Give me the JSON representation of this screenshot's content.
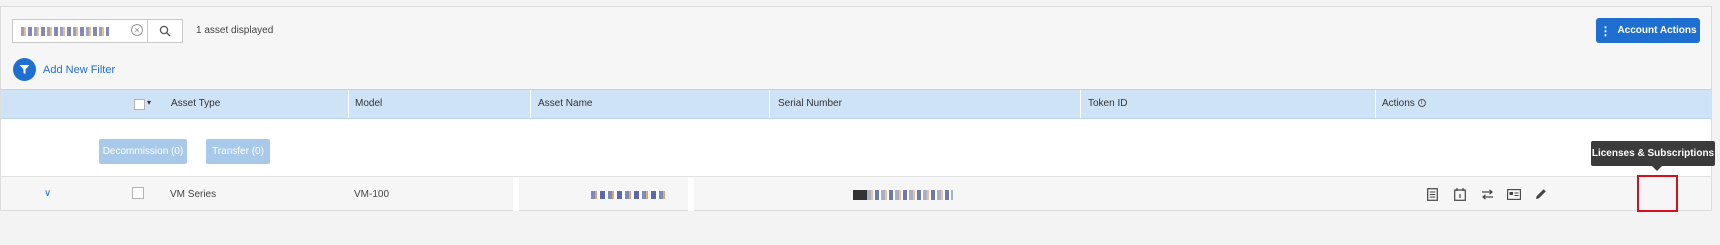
{
  "search": {
    "value": "",
    "placeholder": "",
    "count_text": "1 asset displayed"
  },
  "account_actions": {
    "label": "Account Actions"
  },
  "filter": {
    "label": "Add New Filter"
  },
  "table": {
    "columns": [
      "Asset Type",
      "Model",
      "Asset Name",
      "Serial Number",
      "Token ID",
      "Actions"
    ],
    "rows": [
      {
        "asset_type": "VM Series",
        "model": "VM-100",
        "asset_name": "",
        "serial_number": "",
        "token_id": ""
      }
    ]
  },
  "bulk": {
    "decommission_label": "Decommission (0)",
    "transfer_label": "Transfer (0)"
  },
  "tooltip": {
    "text": "Licenses & Subscriptions"
  },
  "colors": {
    "primary": "#1f6fd1",
    "header_bg": "#cfe3f6",
    "disabled_btn": "#a9c9ea",
    "highlight": "#d6101c",
    "tooltip_bg": "#3b3b3b"
  },
  "icons": {
    "search": "magnifier-icon",
    "filter": "funnel-icon",
    "actions": [
      "document-icon",
      "calendar-icon",
      "transfer-icon",
      "license-card-icon",
      "pencil-icon"
    ]
  }
}
